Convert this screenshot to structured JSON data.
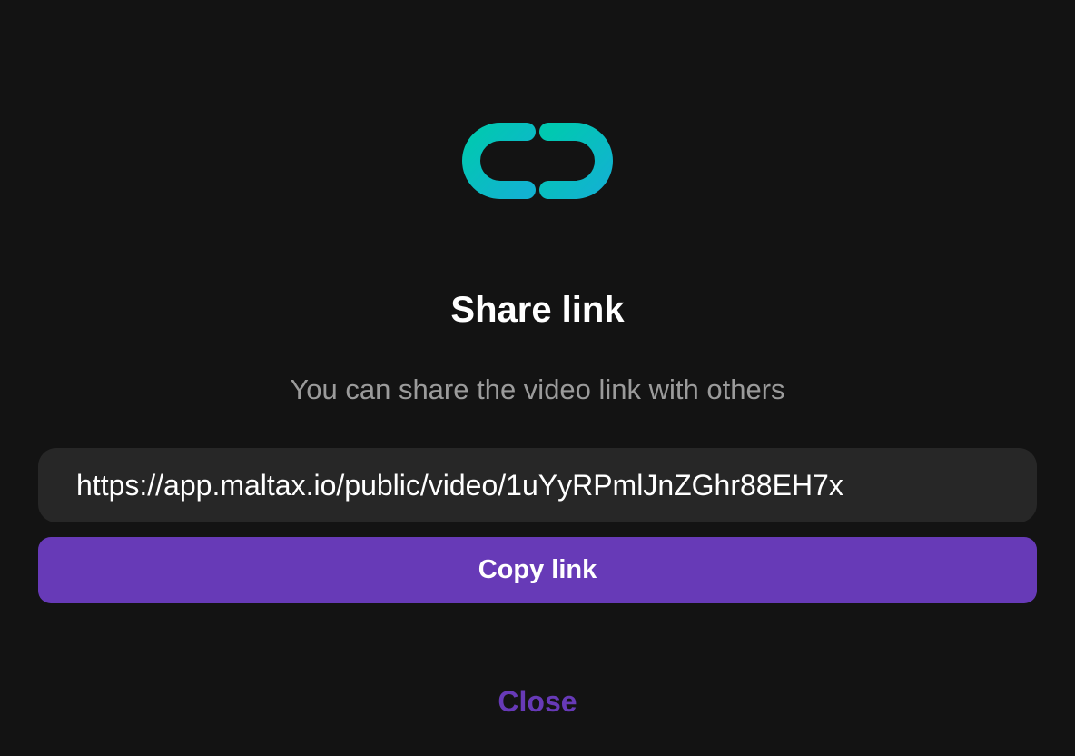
{
  "dialog": {
    "icon": "link-icon",
    "title": "Share link",
    "subtitle": "You can share the video link with others",
    "share_url": "https://app.maltax.io/public/video/1uYyRPmlJnZGhr88EH7x",
    "copy_label": "Copy link",
    "close_label": "Close"
  },
  "colors": {
    "background": "#131313",
    "field_background": "#272727",
    "accent": "#673ab7",
    "icon_gradient_start": "#00c9b0",
    "icon_gradient_end": "#12b2d1",
    "subtitle_text": "#9b9b9b"
  }
}
